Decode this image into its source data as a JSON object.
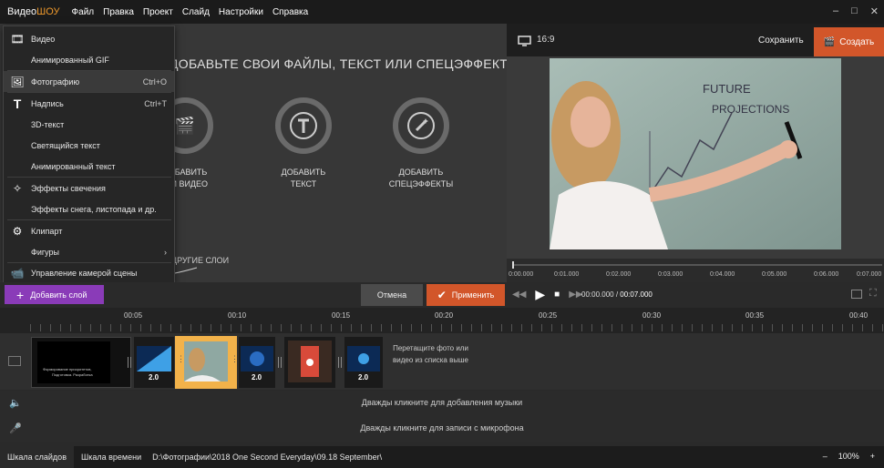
{
  "app": {
    "logo_part1": "Видео",
    "logo_part2": "ШОУ"
  },
  "menubar": [
    "Файл",
    "Правка",
    "Проект",
    "Слайд",
    "Настройки",
    "Справка"
  ],
  "window_controls": [
    "–",
    "□",
    "✕"
  ],
  "left": {
    "title": "ДОБАВЬТЕ СВОИ ФАЙЛЫ, ТЕКСТ ИЛИ СПЕЦЭФФЕКТЫ",
    "tiles": [
      {
        "line1": "ДОБАВИТЬ",
        "line2": "О И ВИДЕО"
      },
      {
        "line1": "ДОБАВИТЬ",
        "line2": "ТЕКСТ"
      },
      {
        "line1": "ДОБАВИТЬ",
        "line2": "СПЕЦЭФФЕКТЫ"
      }
    ],
    "other_layers": "ДРУГИЕ СЛОИ"
  },
  "dropdown": [
    {
      "label": "Видео",
      "icon": "film-icon",
      "shortcut": ""
    },
    {
      "label": "Анимированный GIF",
      "icon": "",
      "shortcut": ""
    },
    {
      "label": "Фотографию",
      "icon": "image-icon",
      "shortcut": "Ctrl+O"
    },
    {
      "label": "Надпись",
      "icon": "text-icon",
      "shortcut": "Ctrl+T"
    },
    {
      "label": "3D-текст",
      "icon": "",
      "shortcut": ""
    },
    {
      "label": "Светящийся текст",
      "icon": "",
      "shortcut": ""
    },
    {
      "label": "Анимированный текст",
      "icon": "",
      "shortcut": ""
    },
    {
      "label": "Эффекты свечения",
      "icon": "magic-wand-icon",
      "shortcut": ""
    },
    {
      "label": "Эффекты снега, листопада и др.",
      "icon": "",
      "shortcut": ""
    },
    {
      "label": "Клипарт",
      "icon": "gear-icon",
      "shortcut": ""
    },
    {
      "label": "Фигуры",
      "icon": "",
      "shortcut": "›"
    },
    {
      "label": "Управление камерой сцены",
      "icon": "camera-icon",
      "shortcut": ""
    }
  ],
  "preview": {
    "ratio": "16:9",
    "save": "Сохранить",
    "create": "Создать",
    "board_text1": "FUTURE",
    "board_text2": "PROJECTIONS",
    "ruler": [
      "0:00.000",
      "0:01.000",
      "0:02.000",
      "0:03.000",
      "0:04.000",
      "0:05.000",
      "0:06.000",
      "0:07.000"
    ]
  },
  "toolbar": {
    "add_layer": "Добавить слой",
    "cancel": "Отмена",
    "apply": "Применить",
    "time_current": "00:00.000",
    "time_sep": " / ",
    "time_total": "00:07.000"
  },
  "timeline": {
    "ticks": [
      "00:05",
      "00:10",
      "00:15",
      "00:20",
      "00:25",
      "00:30",
      "00:35",
      "00:40"
    ],
    "clip_durations": [
      "2.0",
      "2.0",
      "2.0",
      "2.0",
      "2.0"
    ],
    "title_slide_line1": "Формирование приоритетов,",
    "title_slide_line2": "Подготовка. Разработка",
    "drop_hint": "Перетащите фото или видео из списка выше",
    "music_hint": "Дважды кликните для добавления музыки",
    "mic_hint": "Дважды кликните для записи с микрофона"
  },
  "status": {
    "tab_slides": "Шкала слайдов",
    "tab_timeline": "Шкала времени",
    "path": "D:\\Фотографии\\2018 One Second Everyday\\09.18 September\\",
    "zoom_minus": "–",
    "zoom": "100%",
    "zoom_plus": "+"
  },
  "colors": {
    "accent": "#d2562a",
    "add_layer": "#8a3bb8",
    "selected_clip": "#f2b24a"
  }
}
